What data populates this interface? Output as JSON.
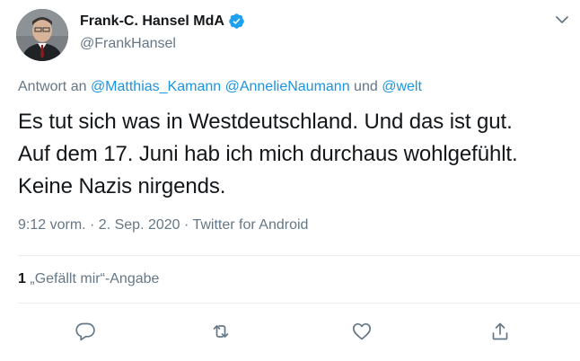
{
  "author": {
    "display_name": "Frank-C. Hansel MdA",
    "handle": "@FrankHansel",
    "verified": true
  },
  "reply": {
    "prefix": "Antwort an",
    "mention_1": "@Matthias_Kamann",
    "mention_2": "@AnnelieNaumann",
    "conjunction": "und",
    "mention_3": "@welt"
  },
  "tweet": {
    "line_1": "Es tut sich was in Westdeutschland. Und das ist gut.",
    "line_2": "Auf dem 17. Juni hab ich mich durchaus wohlgefühlt.",
    "line_3": "Keine Nazis nirgends."
  },
  "meta": {
    "timestamp": "9:12 vorm. · 2. Sep. 2020 · Twitter for Android"
  },
  "stats": {
    "likes_count": "1",
    "likes_label": "„Gefällt mir“-Angabe"
  },
  "colors": {
    "link": "#1b95e0",
    "muted": "#657786",
    "text": "#14171a",
    "verified": "#1da1f2"
  },
  "icons": [
    "chevron-down-icon",
    "verified-badge-icon",
    "reply-icon",
    "retweet-icon",
    "like-icon",
    "share-icon"
  ]
}
